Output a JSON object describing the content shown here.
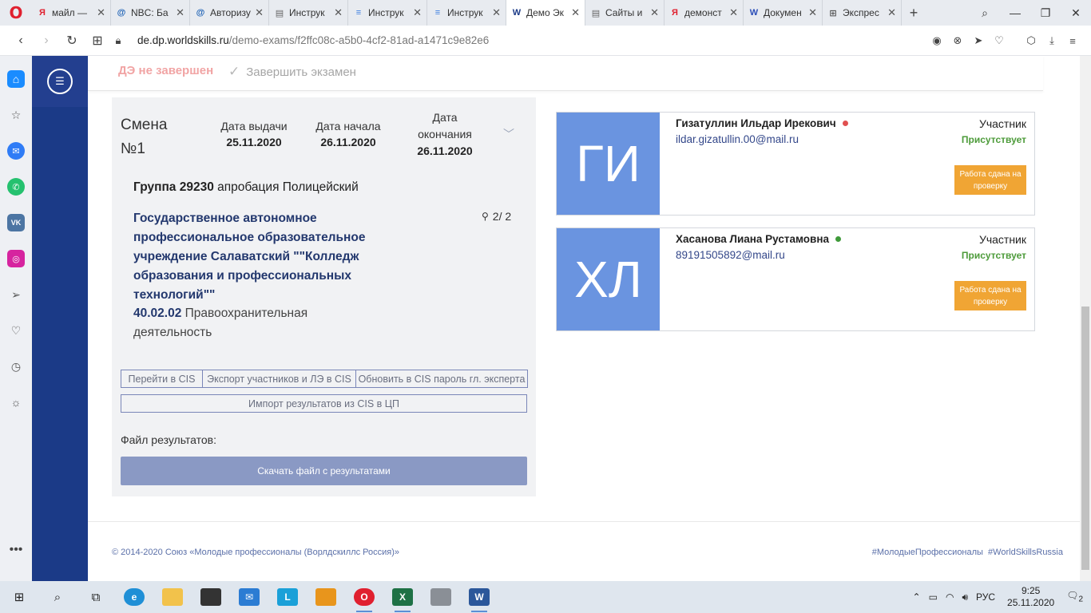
{
  "browser": {
    "tabs": [
      {
        "title": "майл —",
        "icon": "yandex-icon",
        "icon_text": "Я",
        "icon_color": "#e0202f"
      },
      {
        "title": "NBC: Ба",
        "icon": "mail-at-icon",
        "icon_text": "@",
        "icon_color": "#1a5fb4"
      },
      {
        "title": "Авторизу",
        "icon": "mail-at-icon",
        "icon_text": "@",
        "icon_color": "#1a5fb4"
      },
      {
        "title": "Инструк",
        "icon": "document-icon",
        "icon_text": "▤",
        "icon_color": "#666666"
      },
      {
        "title": "Инструк",
        "icon": "google-docs-icon",
        "icon_text": "≡",
        "icon_color": "#3b7de0"
      },
      {
        "title": "Инструк",
        "icon": "google-docs-icon",
        "icon_text": "≡",
        "icon_color": "#3b7de0"
      },
      {
        "title": "Демо Эк",
        "icon": "worldskills-icon",
        "icon_text": "W",
        "icon_color": "#1b3a87",
        "active": true
      },
      {
        "title": "Сайты и",
        "icon": "document-icon",
        "icon_text": "▤",
        "icon_color": "#666666"
      },
      {
        "title": "демонст",
        "icon": "yandex-icon",
        "icon_text": "Я",
        "icon_color": "#e0202f"
      },
      {
        "title": "Докумен",
        "icon": "worldskills-icon",
        "icon_text": "W",
        "icon_color": "#2a4db8"
      },
      {
        "title": "Экспрес",
        "icon": "grid-icon",
        "icon_text": "⊞",
        "icon_color": "#555555"
      }
    ],
    "url_host": "de.dp.worldskills.ru",
    "url_path": "/demo-exams/f2ffc08c-a5b0-4cf2-81ad-a1471c9e82e6"
  },
  "header": {
    "status": "ДЭ не завершен",
    "finish_label": "Завершить экзамен"
  },
  "shift": {
    "title": "Смена №1",
    "issue_label": "Дата выдачи",
    "issue_date": "25.11.2020",
    "start_label": "Дата начала",
    "start_date": "26.11.2020",
    "end_label": "Дата окончания",
    "end_date": "26.11.2020",
    "group_label": "Группа 29230",
    "group_name": "апробация Полицейский",
    "org": "Государственное автономное профессиональное образовательное учреждение Салаватский \"\"Колледж образования и профессиональных технологий\"\"",
    "spec_code": "40.02.02",
    "spec_name": "Правоохранительная деятельность",
    "participants_count": "2/ 2",
    "buttons": {
      "go_cis": "Перейти в CIS",
      "export": "Экспорт участников и ЛЭ в CIS",
      "update_pwd": "Обновить в CIS пароль гл. эксперта",
      "import": "Импорт результатов из CIS в ЦП"
    },
    "file_label": "Файл результатов:",
    "download_label": "Скачать файл с результатами"
  },
  "participants": [
    {
      "initials": "ГИ",
      "name": "Гизатуллин Ильдар Ирекович",
      "email": "ildar.gizatullin.00@mail.ru",
      "role": "Участник",
      "status": "Присутствует",
      "dot_color": "#e05050",
      "action": "Работа сдана на проверку"
    },
    {
      "initials": "ХЛ",
      "name": "Хасанова Лиана Рустамовна",
      "email": "89191505892@mail.ru",
      "role": "Участник",
      "status": "Присутствует",
      "dot_color": "#3f9a3a",
      "action": "Работа сдана на проверку"
    }
  ],
  "footer": {
    "copyright": "© 2014-2020 Союз «Молодые профессионалы (Ворлдскиллс Россия)»",
    "hashtags": "#МолодыеПрофессионалы  #WorldSkillsRussia"
  },
  "taskbar": {
    "lang": "РУС",
    "time": "9:25",
    "date": "25.11.2020",
    "notifications": "2"
  },
  "colors": {
    "nav_bg": "#1b3a87",
    "accent_orange": "#f0a534",
    "avatar_bg": "#6a94e0",
    "present_green": "#4d9b3a"
  }
}
